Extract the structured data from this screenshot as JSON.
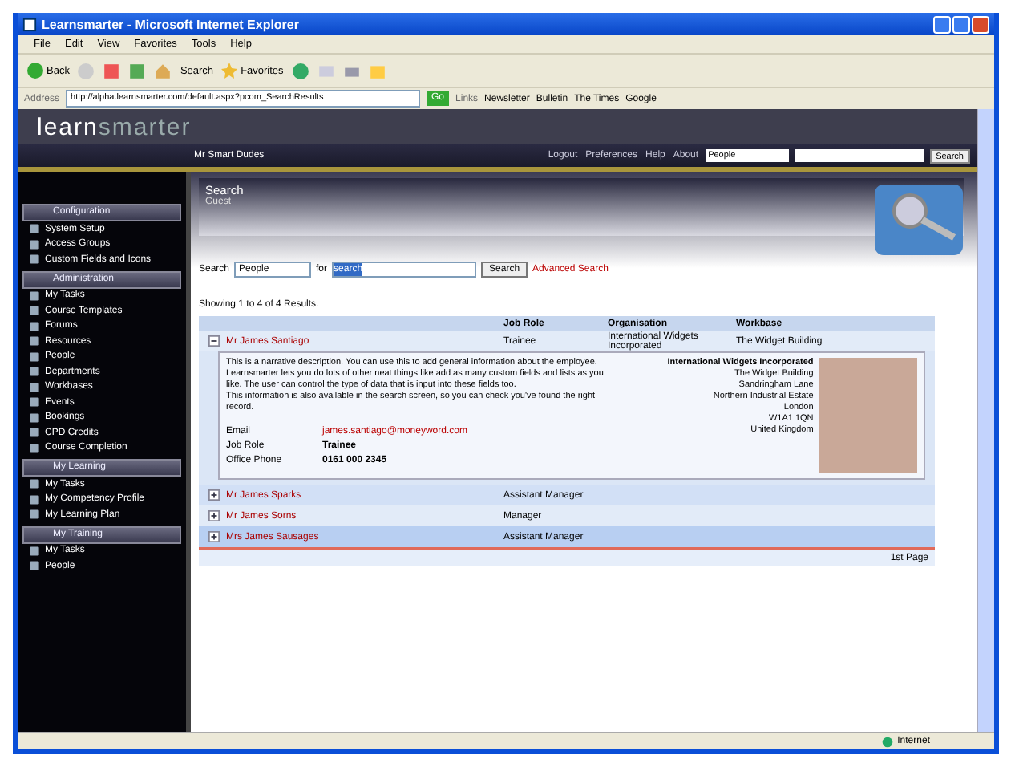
{
  "window": {
    "title": "Learnsmarter - Microsoft Internet Explorer"
  },
  "menu": [
    "File",
    "Edit",
    "View",
    "Favorites",
    "Tools",
    "Help"
  ],
  "toolbar": {
    "back": "Back",
    "search": "Search",
    "favorites": "Favorites"
  },
  "address_bar": {
    "label": "Address",
    "url": "http://alpha.learnsmarter.com/default.aspx?pcom_SearchResults",
    "go": "Go",
    "links_label": "Links",
    "links": [
      "Newsletter",
      "Bulletin",
      "The Times",
      "Google"
    ]
  },
  "app": {
    "logo": {
      "first": "learn",
      "second": "smarter"
    },
    "user": "Mr Smart Dudes",
    "top_links": [
      "Logout",
      "Preferences",
      "Help",
      "About"
    ],
    "search_scope": "People",
    "search_button": "Search"
  },
  "sidebar": [
    {
      "title": "Configuration",
      "items": [
        "System Setup",
        "Access Groups",
        "Custom Fields and Icons"
      ]
    },
    {
      "title": "Administration",
      "items": [
        "My Tasks",
        "Course Templates",
        "Forums",
        "Resources",
        "People",
        "Departments",
        "Workbases",
        "Events",
        "Bookings",
        "CPD Credits",
        "Course Completion"
      ]
    },
    {
      "title": "My Learning",
      "items": [
        "My Tasks",
        "My Competency Profile",
        "My Learning Plan"
      ]
    },
    {
      "title": "My Training",
      "items": [
        "My Tasks",
        "People"
      ]
    }
  ],
  "page": {
    "title": "Search",
    "subtitle": "Guest"
  },
  "search_form": {
    "label": "Search",
    "scope": "People",
    "for_label": "for",
    "value": "search",
    "button": "Search",
    "advanced": "Advanced Search"
  },
  "results_summary": "Showing 1 to 4 of 4 Results.",
  "table": {
    "columns": [
      "Job Role",
      "Organisation",
      "Workbase"
    ],
    "rows": [
      {
        "name": "Mr James Santiago",
        "job_role": "Trainee",
        "organisation": "International Widgets Incorporated",
        "workbase": "The Widget Building",
        "expanded": true,
        "selected": false
      },
      {
        "name": "Mr James Sparks",
        "job_role": "Assistant Manager",
        "expanded": false,
        "selected": false
      },
      {
        "name": "Mr James Sorns",
        "job_role": "Manager",
        "expanded": false,
        "selected": false
      },
      {
        "name": "Mrs James Sausages",
        "job_role": "Assistant Manager",
        "expanded": false,
        "selected": true
      }
    ],
    "footer": "1st Page"
  },
  "detail": {
    "description": "This is a narrative description. You can use this to add general information about the employee. Learnsmarter lets you do lots of other neat things like add as many custom fields and lists as you like. The user can control the type of data that is input into these fields too.",
    "note": "This information is also available in the search screen, so you can check you've found the right record.",
    "fields": [
      {
        "label": "Email",
        "value": "james.santiago@moneyword.com",
        "kind": "link"
      },
      {
        "label": "Job Role",
        "value": "Trainee",
        "kind": "bold"
      },
      {
        "label": "Office Phone",
        "value": "0161 000 2345",
        "kind": "bold"
      }
    ],
    "address": [
      "International Widgets Incorporated",
      "The Widget Building",
      "Sandringham Lane",
      "Northern Industrial Estate",
      "London",
      "W1A1 1QN",
      "United Kingdom"
    ]
  },
  "status_bar": {
    "zone": "Internet"
  }
}
